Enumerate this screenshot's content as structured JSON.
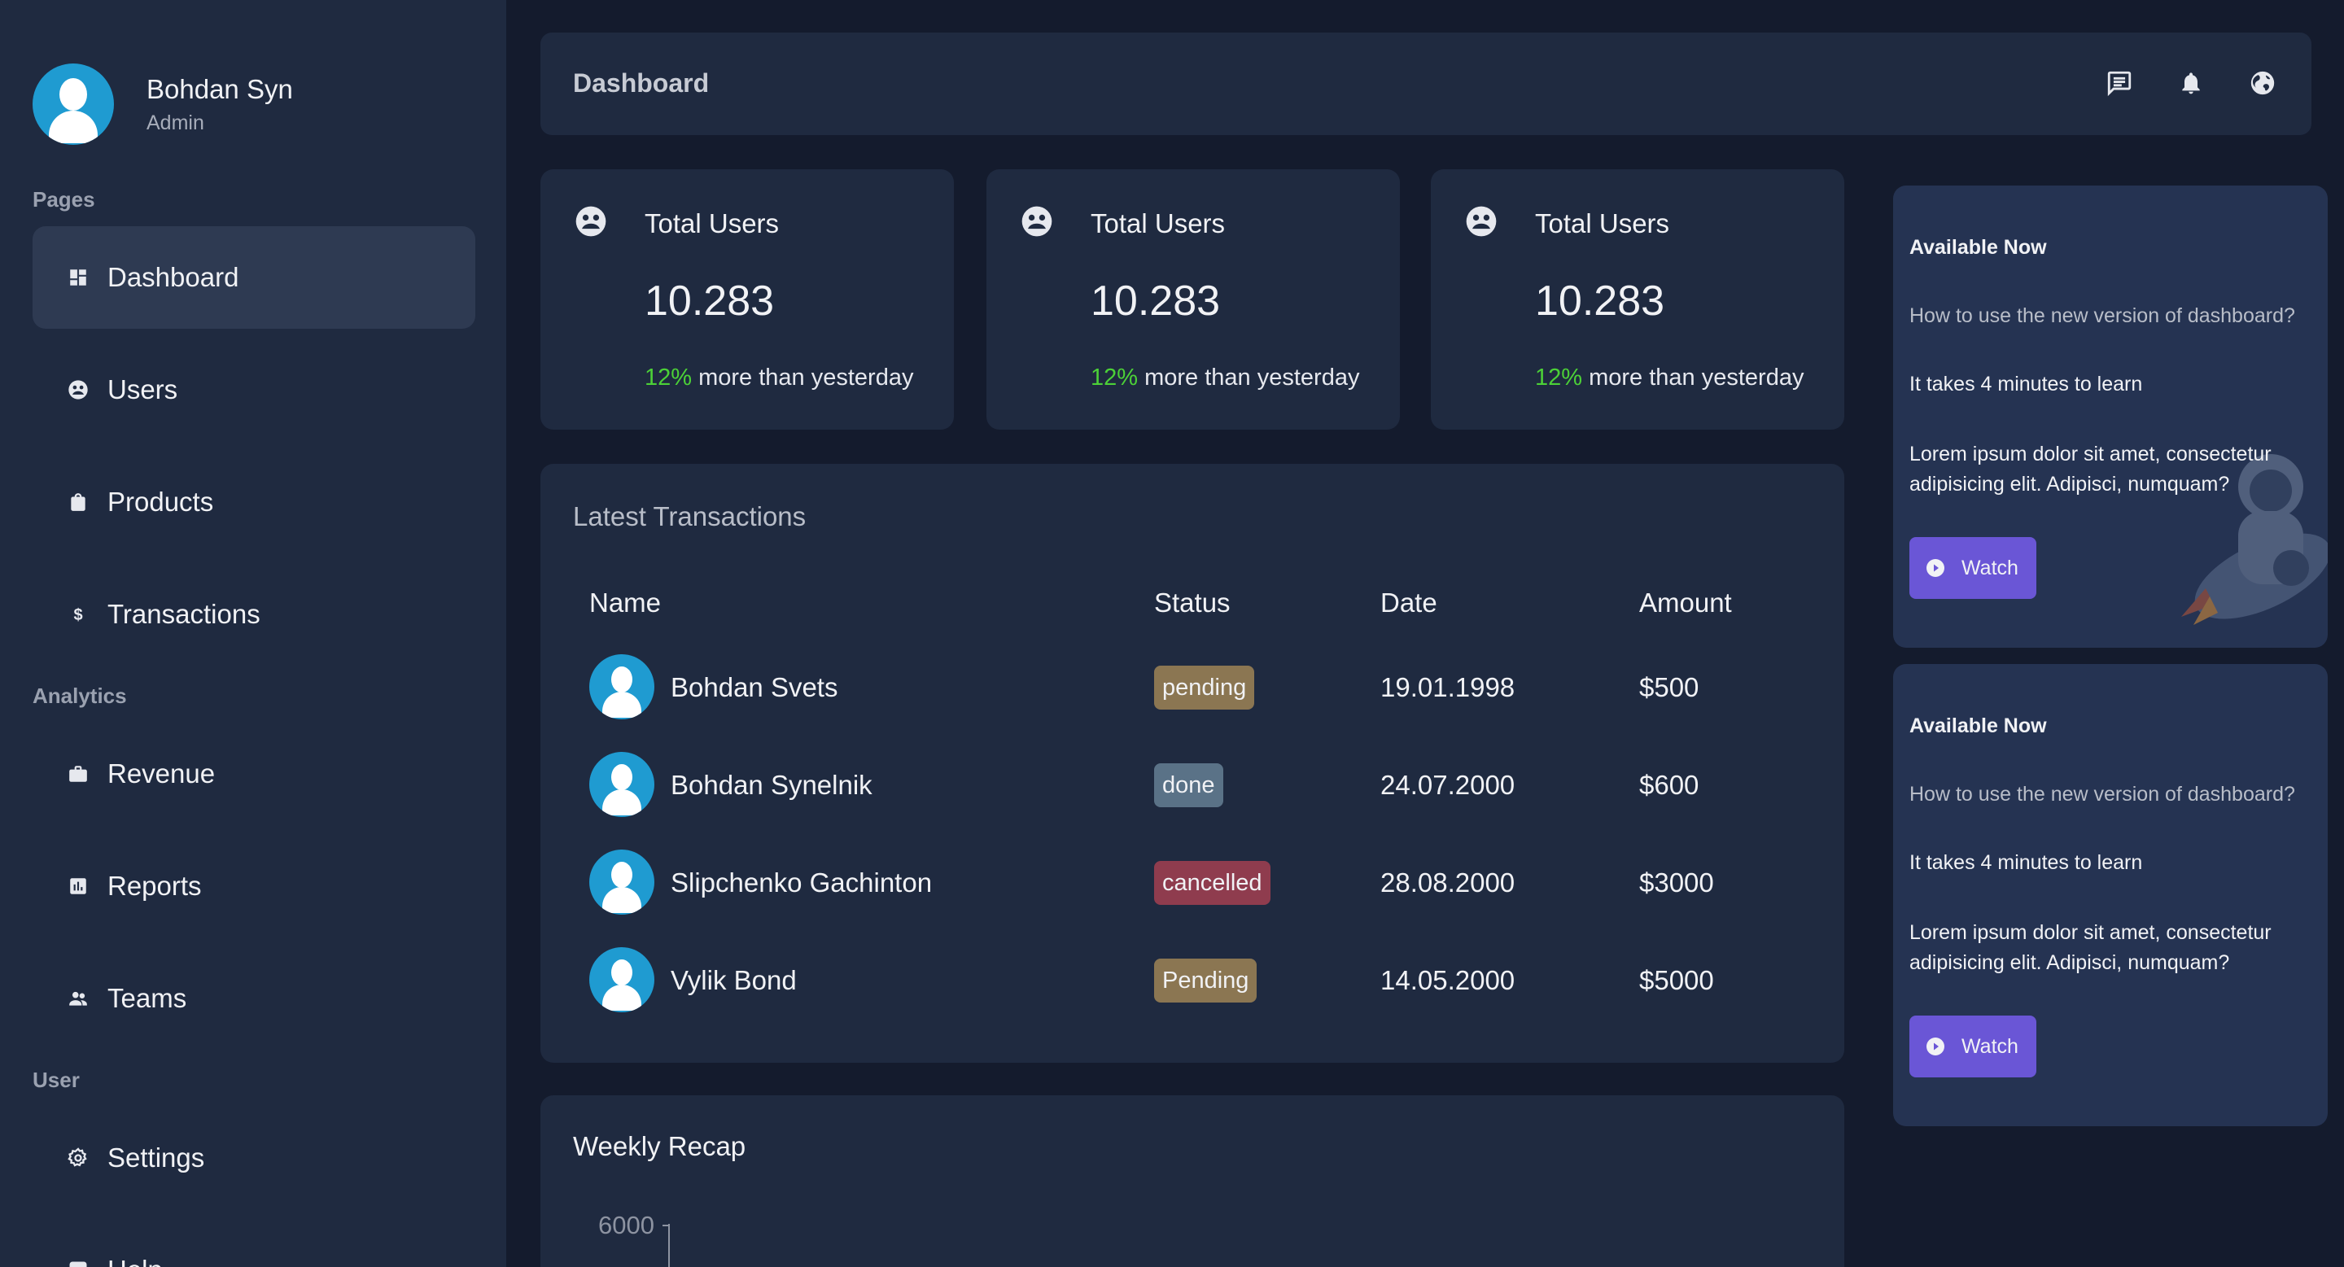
{
  "sidebar": {
    "user": {
      "name": "Bohdan Syn",
      "role": "Admin"
    },
    "sections": {
      "pages": "Pages",
      "analytics": "Analytics",
      "user": "User"
    },
    "items": {
      "dashboard": "Dashboard",
      "users": "Users",
      "products": "Products",
      "transactions": "Transactions",
      "revenue": "Revenue",
      "reports": "Reports",
      "teams": "Teams",
      "settings": "Settings",
      "help": "Help"
    }
  },
  "header": {
    "title": "Dashboard",
    "icons": [
      "message-icon",
      "bell-icon",
      "globe-icon"
    ]
  },
  "stats": [
    {
      "title": "Total Users",
      "value": "10.283",
      "change_pct": "12%",
      "change_text": " more than yesterday"
    },
    {
      "title": "Total Users",
      "value": "10.283",
      "change_pct": "12%",
      "change_text": " more than yesterday"
    },
    {
      "title": "Total Users",
      "value": "10.283",
      "change_pct": "12%",
      "change_text": " more than yesterday"
    }
  ],
  "transactions": {
    "title": "Latest Transactions",
    "columns": {
      "name": "Name",
      "status": "Status",
      "date": "Date",
      "amount": "Amount"
    },
    "rows": [
      {
        "name": "Bohdan Svets",
        "status": "pending",
        "date": "19.01.1998",
        "amount": "$500"
      },
      {
        "name": "Bohdan Synelnik",
        "status": "done",
        "date": "24.07.2000",
        "amount": "$600"
      },
      {
        "name": "Slipchenko Gachinton",
        "status": "cancelled",
        "date": "28.08.2000",
        "amount": "$3000"
      },
      {
        "name": "Vylik Bond",
        "status": "Pending",
        "date": "14.05.2000",
        "amount": "$5000"
      }
    ]
  },
  "recap": {
    "title": "Weekly Recap",
    "y_tick_top": "6000"
  },
  "promos": [
    {
      "title": "Available Now",
      "question": "How to use the new version of dashboard?",
      "time": "It takes 4 minutes to learn",
      "text": "Lorem ipsum dolor sit amet, consectetur adipisicing elit. Adipisci, numquam?",
      "button": "Watch"
    },
    {
      "title": "Available Now",
      "question": "How to use the new version of dashboard?",
      "time": "It takes 4 minutes to learn",
      "text": "Lorem ipsum dolor sit amet, consectetur adipisicing elit. Adipisci, numquam?",
      "button": "Watch"
    }
  ],
  "colors": {
    "background": "#141b2d",
    "panel": "#1f2a40",
    "accent_green": "#4cd137",
    "accent_purple": "#6a56d6",
    "avatar_blue": "#1f9bd1"
  }
}
